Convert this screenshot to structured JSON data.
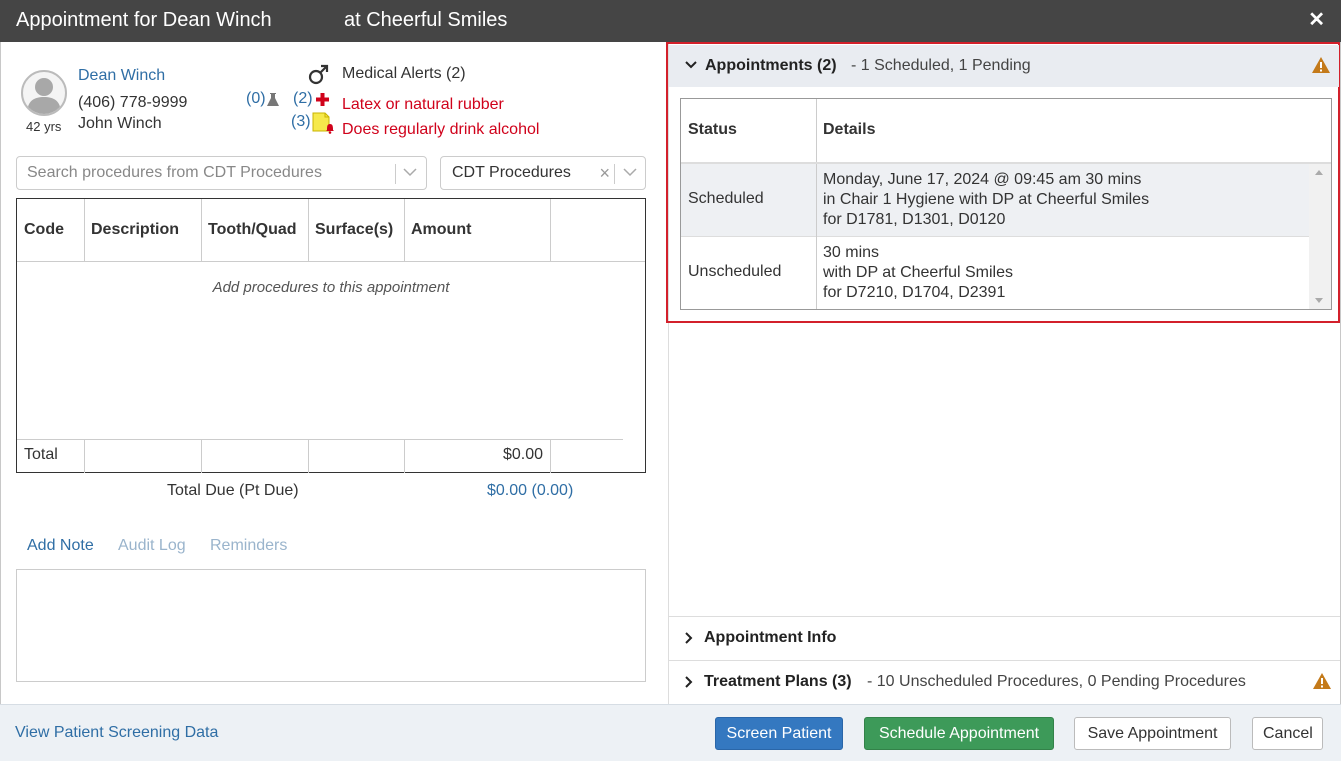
{
  "window": {
    "title_prefix": "Appointment for Dean Winch",
    "title_suffix": "at Cheerful Smiles",
    "close_glyph": "✕"
  },
  "patient": {
    "name": "Dean Winch",
    "phone": "(406) 778-9999",
    "guardian": "John Winch",
    "age": "42 yrs",
    "avatar_icon": "person-silhouette-icon",
    "gender_icon": "male-symbol-icon"
  },
  "alerts": {
    "lab_count": "(0)",
    "lab_icon": "flask-icon",
    "medical_title": "Medical Alerts (2)",
    "medical_count": "(2)",
    "medical_icon": "red-cross-icon",
    "notes_count": "(3)",
    "notes_icon": "note-bell-icon",
    "items": [
      "Latex or natural rubber",
      "Does regularly drink alcohol"
    ],
    "alert_color": "#d0021b"
  },
  "search": {
    "placeholder": "Search procedures from CDT Procedures",
    "category": "CDT Procedures",
    "clear_glyph": "×"
  },
  "procedures": {
    "columns": [
      "Code",
      "Description",
      "Tooth/Quad",
      "Surface(s)",
      "Amount"
    ],
    "empty_message": "Add procedures to this appointment",
    "total_label": "Total",
    "total_value": "$0.00",
    "due_label": "Total Due (Pt Due)",
    "due_value": "$0.00 (0.00)"
  },
  "note_tabs": [
    "Add Note",
    "Audit Log",
    "Reminders"
  ],
  "appointments": {
    "title": "Appointments (2)",
    "summary": "- 1 Scheduled, 1 Pending",
    "columns": [
      "Status",
      "Details"
    ],
    "rows": [
      {
        "status": "Scheduled",
        "details": [
          "Monday, June 17, 2024 @ 09:45 am 30 mins",
          "in Chair 1 Hygiene with DP at Cheerful Smiles",
          "for D1781, D1301, D0120"
        ]
      },
      {
        "status": "Unscheduled",
        "details": [
          "30 mins",
          "with DP at Cheerful Smiles",
          "for D7210, D1704, D2391"
        ]
      }
    ],
    "highlight_color": "#d3202b"
  },
  "sections": {
    "info_title": "Appointment Info",
    "plans_title": "Treatment Plans (3)",
    "plans_summary": "- 10 Unscheduled Procedures, 0 Pending Procedures",
    "warning_color": "#c47a1a"
  },
  "footer": {
    "link": "View Patient Screening Data",
    "screen_button": "Screen Patient",
    "schedule_button": "Schedule Appointment",
    "save_button": "Save Appointment",
    "cancel_button": "Cancel"
  }
}
